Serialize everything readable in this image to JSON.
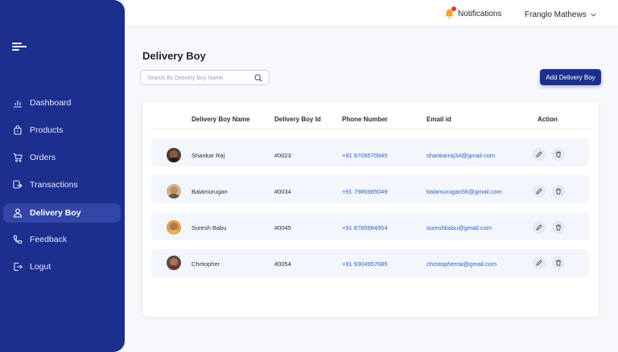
{
  "sidebar": {
    "items": [
      {
        "label": "Dashboard",
        "icon": "chart-icon"
      },
      {
        "label": "Products",
        "icon": "bag-icon"
      },
      {
        "label": "Orders",
        "icon": "cart-icon"
      },
      {
        "label": "Transactions",
        "icon": "transfer-icon"
      },
      {
        "label": "Delivery Boy",
        "icon": "user-icon",
        "active": true
      },
      {
        "label": "Feedback",
        "icon": "phone-icon"
      },
      {
        "label": "Logut",
        "icon": "logout-icon"
      }
    ]
  },
  "topbar": {
    "notifications_label": "Notifications",
    "user_name": "Franglo Mathews"
  },
  "page": {
    "title": "Delivery Boy",
    "search_placeholder": "Search By Delivery Boy Name",
    "add_button": "Add Delivery Boy"
  },
  "table": {
    "headers": [
      "Delivery Boy Name",
      "Delivery Boy Id",
      "Phone Number",
      "Email id",
      "Action"
    ],
    "rows": [
      {
        "name": "Shankar Raj",
        "id": "#0023",
        "phone": "+91 9709570945",
        "email": "shankarraj34@gmail.com"
      },
      {
        "name": "Balamurugan",
        "id": "#0034",
        "phone": "+91 7986985049",
        "email": "balamurugan56@gmail.com"
      },
      {
        "name": "Suresh Babu",
        "id": "#0045",
        "phone": "+91 8785984954",
        "email": "sureshbabu@gmail.com"
      },
      {
        "name": "Chritopher",
        "id": "#0054",
        "phone": "+91 9304957685",
        "email": "christopherrai@gmail.com"
      }
    ]
  },
  "colors": {
    "sidebar": "#1c2f8e",
    "active_item": "#3346a8",
    "link": "#3060c8",
    "notification_bell": "#f5a623",
    "notification_dot": "#e53935"
  }
}
